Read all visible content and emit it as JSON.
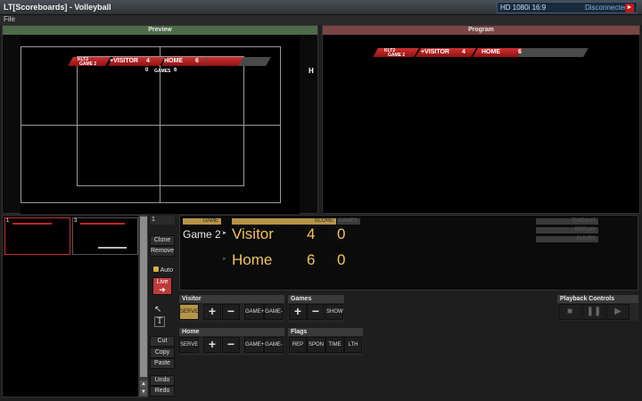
{
  "window": {
    "title": "LT[Scoreboards] - Volleyball"
  },
  "status": {
    "format": "HD 1080i 16:9",
    "connection": "Disconnected"
  },
  "menu": {
    "file": "File"
  },
  "preview": {
    "label": "Preview",
    "marker": "H"
  },
  "program": {
    "label": "Program"
  },
  "lowerthird": {
    "event": "KLT2",
    "game": "GAME 2",
    "visitor": "+VISITOR",
    "visitor_score": "4",
    "home": "HOME",
    "home_score": "6",
    "visitor_sets": "0",
    "games_label": "GAMES",
    "home_sets": "6"
  },
  "thumbnails": [
    {
      "index": "1"
    },
    {
      "index": "3"
    }
  ],
  "side": {
    "layer": "1",
    "clone": "Clone",
    "remove": "Remove",
    "auto": "Auto",
    "live": "Live",
    "cut": "Cut",
    "copy": "Copy",
    "paste": "Paste",
    "undo": "Undo",
    "redo": "Redo"
  },
  "scoreboard": {
    "game_header": "GAME",
    "score_header": "SCORE",
    "sets_header": "GAMES",
    "game": "Game 2",
    "visitor_team": "Visitor",
    "visitor_score": "4",
    "visitor_sets": "0",
    "home_team": "Home",
    "home_score": "6",
    "home_sets": "0",
    "right_labels": [
      "TIMEOUT",
      "REPLAY",
      "INJURY"
    ]
  },
  "visitor_panel": {
    "title": "Visitor",
    "serve": "SERVE",
    "plus": "+",
    "minus": "−",
    "game_plus": "GAME+",
    "game_minus": "GAME-"
  },
  "home_panel": {
    "title": "Home",
    "serve": "SERVE",
    "plus": "+",
    "minus": "−",
    "game_plus": "GAME+",
    "game_minus": "GAME-"
  },
  "games_panel": {
    "title": "Games",
    "plus": "+",
    "minus": "−",
    "show": "SHOW"
  },
  "flags_panel": {
    "title": "Flags",
    "rep": "REP",
    "spon": "SPON",
    "time": "TIME",
    "lth": "LTH"
  },
  "playback": {
    "title": "Playback Controls"
  },
  "colors": {
    "accent": "#b69447",
    "lower_third_red": "#c22626",
    "preview_header": "#4c6b47",
    "program_header": "#7a4545"
  }
}
